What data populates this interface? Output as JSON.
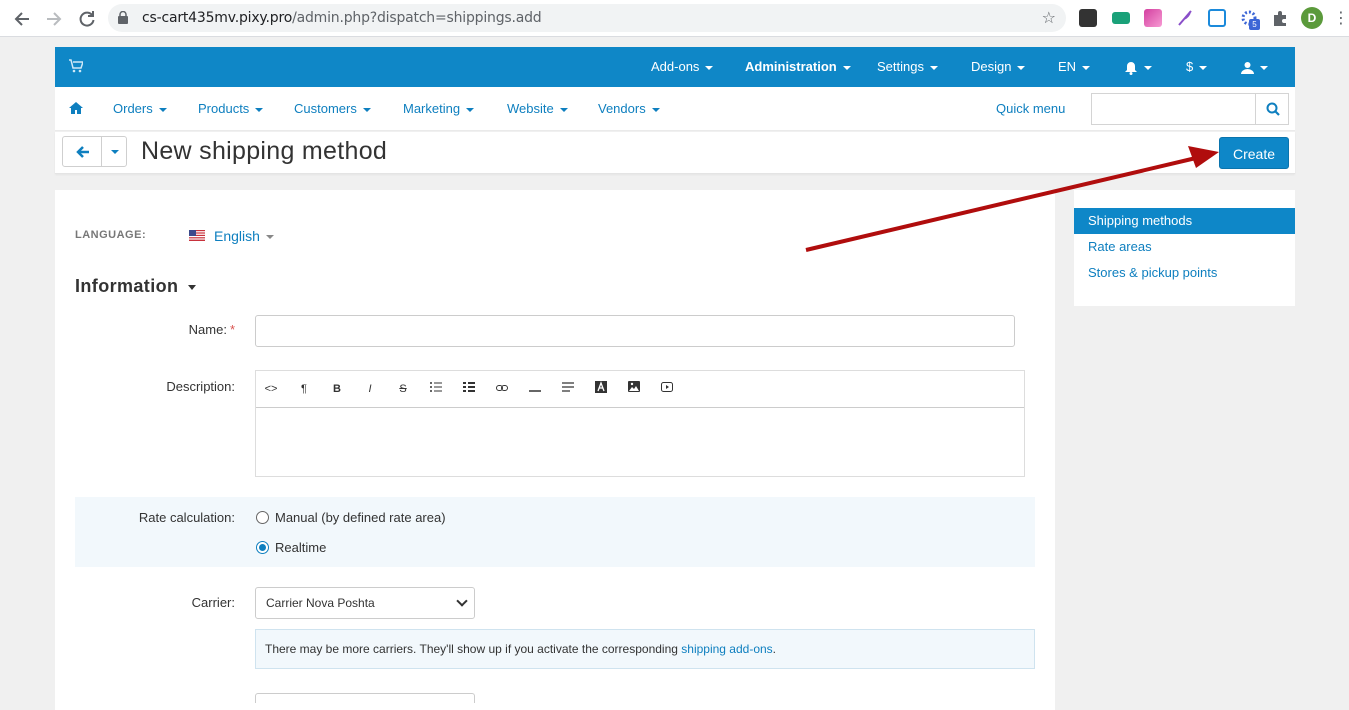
{
  "browser": {
    "url_host": "cs-cart435mv.pixy.pro",
    "url_path": "/admin.php?dispatch=shippings.add",
    "profile_initial": "D",
    "ext_badge": "5"
  },
  "topbar": {
    "menus": [
      "Add-ons",
      "Administration",
      "Settings",
      "Design",
      "EN",
      "",
      "$",
      ""
    ]
  },
  "subnav": {
    "items": [
      "Orders",
      "Products",
      "Customers",
      "Marketing",
      "Website",
      "Vendors"
    ],
    "quick_menu": "Quick menu",
    "search_value": ""
  },
  "titlebar": {
    "title": "New shipping method",
    "create_label": "Create"
  },
  "form": {
    "language_label": "LANGUAGE:",
    "language_value": "English",
    "section_title": "Information",
    "name_label": "Name:",
    "name_value": "",
    "description_label": "Description:",
    "rate_label": "Rate calculation:",
    "rate_options": [
      "Manual (by defined rate area)",
      "Realtime"
    ],
    "rate_selected": "Realtime",
    "carrier_label": "Carrier:",
    "carrier_value": "Carrier Nova Poshta",
    "note_text": "There may be more carriers. They'll show up if you activate the corresponding ",
    "note_link": "shipping add-ons",
    "note_end": "."
  },
  "sidebar": {
    "items": [
      "Shipping methods",
      "Rate areas",
      "Stores & pickup points"
    ],
    "active": "Shipping methods"
  },
  "colors": {
    "brand_blue": "#0f87c7",
    "link_blue": "#0e7fbf",
    "arrow_red": "#b00d0d"
  }
}
